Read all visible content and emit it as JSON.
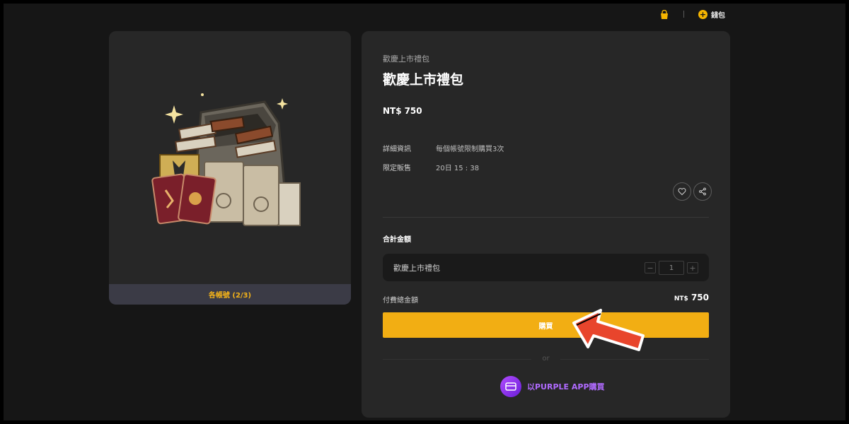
{
  "header": {
    "cart_icon": "shopping-bag-icon",
    "wallet_label": "錢包",
    "wallet_icon": "plus-coin-icon"
  },
  "product_image": {
    "footer_label": "各帳號 (2/3)"
  },
  "product": {
    "breadcrumb": "歡慶上市禮包",
    "title": "歡慶上市禮包",
    "price_currency": "NT$",
    "price_value": "750",
    "details": [
      {
        "key": "詳細資訊",
        "value": "每個帳號限制購買3次"
      },
      {
        "key": "限定販售",
        "value": "20日 15 : 38"
      }
    ]
  },
  "summary": {
    "total_label": "合計金額",
    "item_name": "歡慶上市禮包",
    "quantity": "1",
    "minus": "−",
    "plus": "+",
    "pay_label": "付費總金額",
    "pay_currency": "NT$",
    "pay_value": "750"
  },
  "actions": {
    "buy_label": "購買",
    "or_label": "or",
    "purple_label": "以PURPLE APP購買"
  },
  "colors": {
    "accent": "#f2ae13",
    "footer_text": "#f2b21a",
    "purple": "#b06bff",
    "arrow": "#e8452c"
  }
}
